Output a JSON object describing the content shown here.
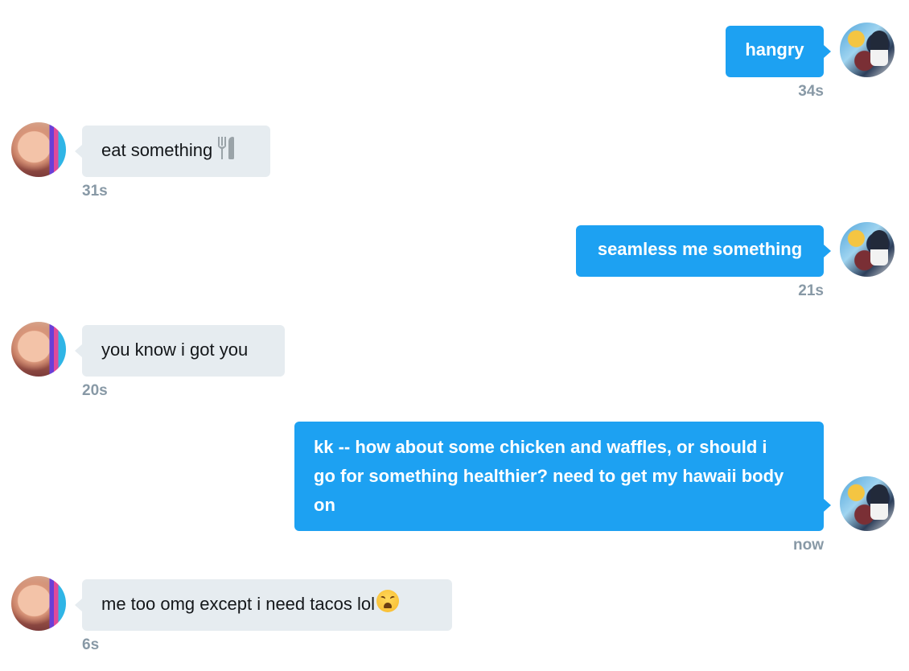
{
  "messages": [
    {
      "direction": "sent",
      "text": "hangry",
      "time": "34s"
    },
    {
      "direction": "received",
      "text": "eat something",
      "emoji": "fork-and-knife",
      "time": "31s"
    },
    {
      "direction": "sent",
      "text": "seamless me something",
      "time": "21s"
    },
    {
      "direction": "received",
      "text": "you know i got you",
      "time": "20s"
    },
    {
      "direction": "sent",
      "text_lines": [
        "kk -- how about some chicken and waffles, or should i",
        "go for something healthier? need to get my hawaii body",
        "on"
      ],
      "time": "now"
    },
    {
      "direction": "received",
      "text": "me too omg except i need tacos lol",
      "emoji": "weary-face",
      "time": "6s"
    }
  ],
  "colors": {
    "sent_bubble": "#1da1f2",
    "received_bubble": "#e6ecf0",
    "timestamp": "#8899a6"
  }
}
